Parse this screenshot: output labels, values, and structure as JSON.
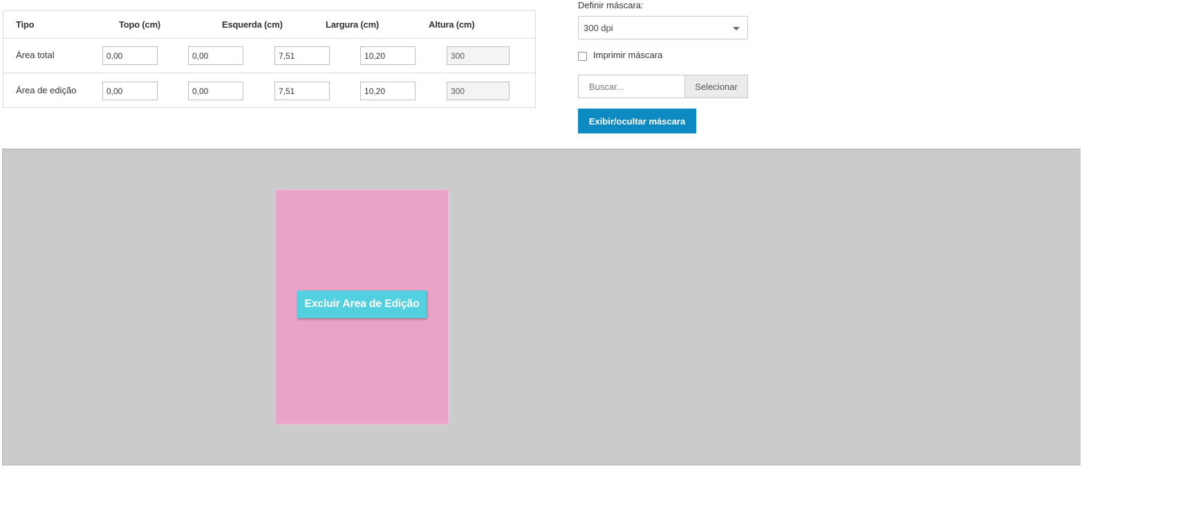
{
  "table": {
    "headers": [
      "Tipo",
      "Topo (cm)",
      "Esquerda (cm)",
      "Largura (cm)",
      "Altura (cm)"
    ],
    "rows": [
      {
        "label": "Área total",
        "values": [
          "0,00",
          "0,00",
          "7,51",
          "10,20",
          "300"
        ]
      },
      {
        "label": "Área de edição",
        "values": [
          "0,00",
          "0,00",
          "7,51",
          "10,20",
          "300"
        ]
      }
    ]
  },
  "mask": {
    "label": "Definir máscara:",
    "selected": "300 dpi",
    "print_label": "Imprimir máscara",
    "print_checked": false,
    "search_placeholder": "Buscar...",
    "select_label": "Selecionar",
    "toggle_label": "Exibir/ocultar máscara"
  },
  "canvas": {
    "delete_label": "Excluir Area de Edição"
  },
  "colors": {
    "primary": "#0e8ac2",
    "canvas_bg": "#cbcbcb",
    "edit_area": "#e8a3c7",
    "delete_button": "#52d0e0"
  }
}
